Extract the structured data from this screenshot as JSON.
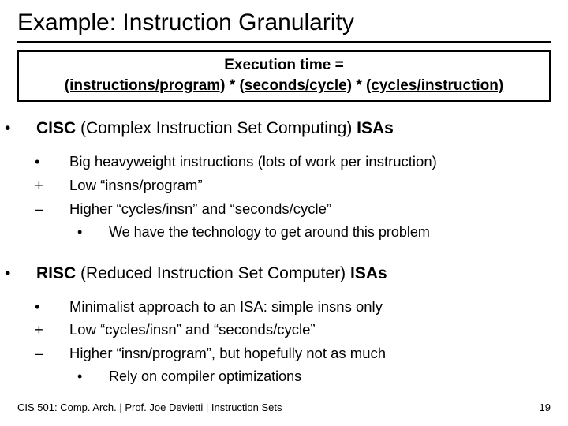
{
  "title": "Example: Instruction Granularity",
  "formula": {
    "line1": "Execution time =",
    "l2a": "(instructions/program)",
    "l2b": " * ",
    "l2c": "(seconds/cycle)",
    "l2d": " * ",
    "l2e": "(cycles/instruction)"
  },
  "cisc": {
    "head_a": "CISC",
    "head_b": " (Complex Instruction Set Computing) ",
    "head_c": "ISAs",
    "b1": "Big heavyweight instructions (lots of work per instruction)",
    "b2": "Low “insns/program”",
    "b3": "Higher “cycles/insn” and “seconds/cycle”",
    "b3a": "We have the technology to get around this problem"
  },
  "risc": {
    "head_a": "RISC",
    "head_b": " (Reduced Instruction Set Computer) ",
    "head_c": "ISAs",
    "b1": "Minimalist approach to an ISA: simple insns only",
    "b2": "Low “cycles/insn” and “seconds/cycle”",
    "b3": "Higher “insn/program”, but hopefully not as much",
    "b3a": "Rely on compiler optimizations"
  },
  "footer": {
    "left": "CIS 501: Comp. Arch.  |  Prof. Joe Devietti  |  Instruction Sets",
    "right": "19"
  },
  "markers": {
    "bullet": "•",
    "plus": "+",
    "minus": "–"
  }
}
